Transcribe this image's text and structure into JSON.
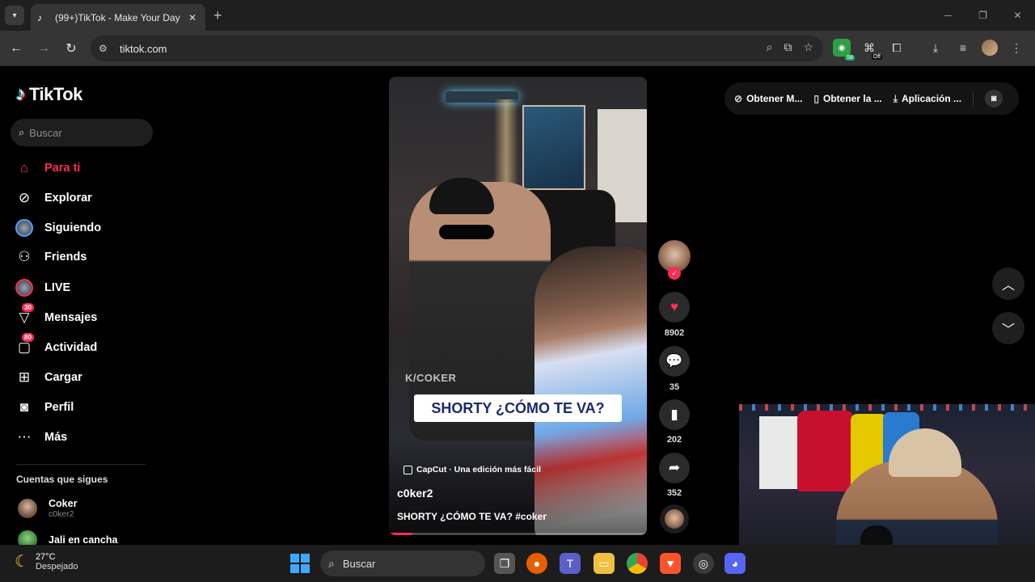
{
  "browser": {
    "tab_title": "(99+)TikTok - Make Your Day",
    "tab_favicon": "tiktok-icon",
    "url": "tiktok.com"
  },
  "sidebar": {
    "logo_text": "TikTok",
    "search_placeholder": "Buscar",
    "nav": [
      {
        "label": "Para ti",
        "icon": "home-icon",
        "active": true
      },
      {
        "label": "Explorar",
        "icon": "compass-icon"
      },
      {
        "label": "Siguiendo",
        "icon": "following-avatar-icon"
      },
      {
        "label": "Friends",
        "icon": "friends-icon"
      },
      {
        "label": "LIVE",
        "icon": "live-icon"
      },
      {
        "label": "Mensajes",
        "icon": "messages-icon",
        "badge": "30"
      },
      {
        "label": "Actividad",
        "icon": "activity-icon",
        "badge": "80"
      },
      {
        "label": "Cargar",
        "icon": "upload-icon"
      },
      {
        "label": "Perfil",
        "icon": "profile-icon"
      },
      {
        "label": "Más",
        "icon": "more-icon"
      }
    ],
    "following_title": "Cuentas que sigues",
    "following": [
      {
        "name": "Coker",
        "handle": "c0ker2"
      },
      {
        "name": "Jali en cancha",
        "handle": ""
      }
    ]
  },
  "video": {
    "watermark": "K/COKER",
    "caption": "SHORTY ¿CÓMO TE VA?",
    "capcut_label": "CapCut · Una edición más fácil",
    "author": "c0ker2",
    "description": "SHORTY ¿CÓMO TE VA? #coker",
    "progress": 0.09
  },
  "actions": {
    "likes": "8902",
    "comments": "35",
    "saves": "202",
    "shares": "352"
  },
  "promo": {
    "item1": "Obtener M...",
    "item2": "Obtener la ...",
    "item3": "Aplicación ..."
  },
  "taskbar": {
    "temperature": "27°C",
    "weather": "Despejado",
    "search_label": "Buscar"
  },
  "colors": {
    "accent": "#fe2c55",
    "background": "#000000"
  }
}
